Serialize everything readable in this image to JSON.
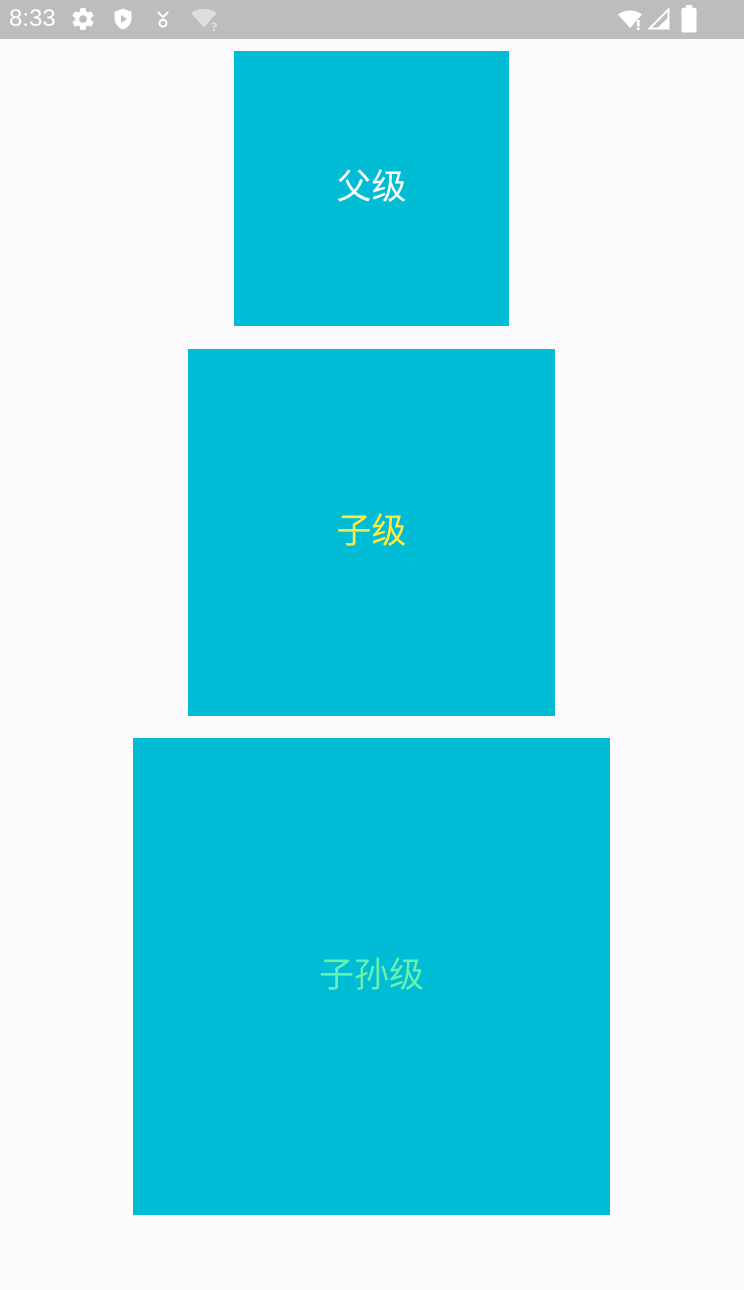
{
  "status_bar": {
    "time": "8:33",
    "left_icons": [
      "settings-icon",
      "play-protect-icon",
      "download-icon",
      "wifi-question-icon"
    ],
    "right_icons": [
      "wifi-icon",
      "signal-icon",
      "battery-icon"
    ],
    "background": "#bebcbf",
    "icon_color": "#ffffff"
  },
  "boxes": {
    "parent": {
      "label": "父级",
      "label_color": "#ffffff",
      "background": "#00bcd4"
    },
    "child": {
      "label": "子级",
      "label_color": "#ffeb3b",
      "background": "#00bcd4"
    },
    "grandchild": {
      "label": "子孙级",
      "label_color": "#69f0ae",
      "background": "#00bcd4"
    }
  },
  "page_background": "#fefbff"
}
